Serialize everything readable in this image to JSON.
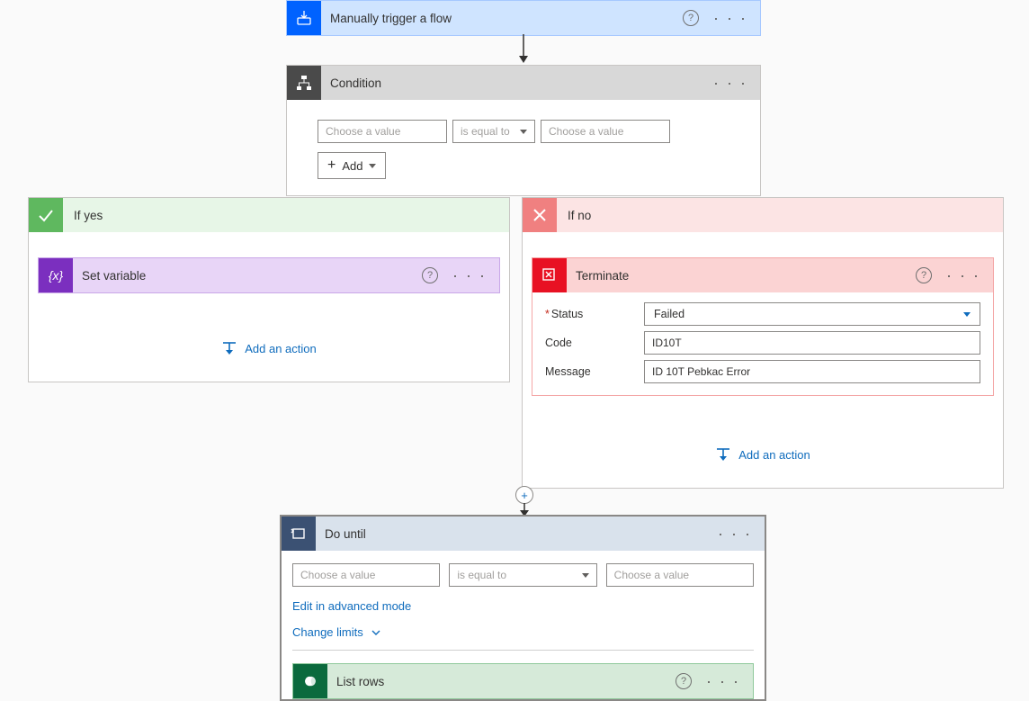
{
  "trigger": {
    "title": "Manually trigger a flow"
  },
  "condition": {
    "title": "Condition",
    "left_placeholder": "Choose a value",
    "operator": "is equal to",
    "right_placeholder": "Choose a value",
    "add_label": "Add"
  },
  "yes": {
    "title": "If yes",
    "action": {
      "title": "Set variable"
    },
    "add_action_label": "Add an action"
  },
  "no": {
    "title": "If no",
    "action": {
      "title": "Terminate",
      "status_label": "Status",
      "status_value": "Failed",
      "code_label": "Code",
      "code_value": "ID10T",
      "message_label": "Message",
      "message_value": "ID 10T Pebkac Error"
    },
    "add_action_label": "Add an action"
  },
  "dountil": {
    "title": "Do until",
    "left_placeholder": "Choose a value",
    "operator": "is equal to",
    "right_placeholder": "Choose a value",
    "advanced_label": "Edit in advanced mode",
    "limits_label": "Change limits",
    "subaction": {
      "title": "List rows"
    }
  }
}
